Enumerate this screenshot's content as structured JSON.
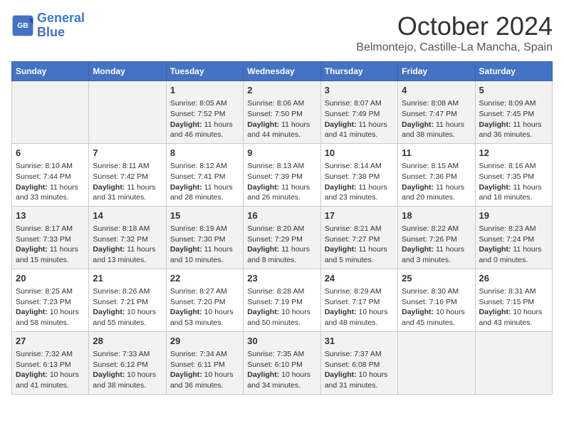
{
  "header": {
    "logo_line1": "General",
    "logo_line2": "Blue",
    "month": "October 2024",
    "location": "Belmontejo, Castille-La Mancha, Spain"
  },
  "days_of_week": [
    "Sunday",
    "Monday",
    "Tuesday",
    "Wednesday",
    "Thursday",
    "Friday",
    "Saturday"
  ],
  "weeks": [
    [
      {
        "day": "",
        "content": ""
      },
      {
        "day": "",
        "content": ""
      },
      {
        "day": "1",
        "content": "Sunrise: 8:05 AM\nSunset: 7:52 PM\nDaylight: 11 hours and 46 minutes."
      },
      {
        "day": "2",
        "content": "Sunrise: 8:06 AM\nSunset: 7:50 PM\nDaylight: 11 hours and 44 minutes."
      },
      {
        "day": "3",
        "content": "Sunrise: 8:07 AM\nSunset: 7:49 PM\nDaylight: 11 hours and 41 minutes."
      },
      {
        "day": "4",
        "content": "Sunrise: 8:08 AM\nSunset: 7:47 PM\nDaylight: 11 hours and 38 minutes."
      },
      {
        "day": "5",
        "content": "Sunrise: 8:09 AM\nSunset: 7:45 PM\nDaylight: 11 hours and 36 minutes."
      }
    ],
    [
      {
        "day": "6",
        "content": "Sunrise: 8:10 AM\nSunset: 7:44 PM\nDaylight: 11 hours and 33 minutes."
      },
      {
        "day": "7",
        "content": "Sunrise: 8:11 AM\nSunset: 7:42 PM\nDaylight: 11 hours and 31 minutes."
      },
      {
        "day": "8",
        "content": "Sunrise: 8:12 AM\nSunset: 7:41 PM\nDaylight: 11 hours and 28 minutes."
      },
      {
        "day": "9",
        "content": "Sunrise: 8:13 AM\nSunset: 7:39 PM\nDaylight: 11 hours and 26 minutes."
      },
      {
        "day": "10",
        "content": "Sunrise: 8:14 AM\nSunset: 7:38 PM\nDaylight: 11 hours and 23 minutes."
      },
      {
        "day": "11",
        "content": "Sunrise: 8:15 AM\nSunset: 7:36 PM\nDaylight: 11 hours and 20 minutes."
      },
      {
        "day": "12",
        "content": "Sunrise: 8:16 AM\nSunset: 7:35 PM\nDaylight: 11 hours and 18 minutes."
      }
    ],
    [
      {
        "day": "13",
        "content": "Sunrise: 8:17 AM\nSunset: 7:33 PM\nDaylight: 11 hours and 15 minutes."
      },
      {
        "day": "14",
        "content": "Sunrise: 8:18 AM\nSunset: 7:32 PM\nDaylight: 11 hours and 13 minutes."
      },
      {
        "day": "15",
        "content": "Sunrise: 8:19 AM\nSunset: 7:30 PM\nDaylight: 11 hours and 10 minutes."
      },
      {
        "day": "16",
        "content": "Sunrise: 8:20 AM\nSunset: 7:29 PM\nDaylight: 11 hours and 8 minutes."
      },
      {
        "day": "17",
        "content": "Sunrise: 8:21 AM\nSunset: 7:27 PM\nDaylight: 11 hours and 5 minutes."
      },
      {
        "day": "18",
        "content": "Sunrise: 8:22 AM\nSunset: 7:26 PM\nDaylight: 11 hours and 3 minutes."
      },
      {
        "day": "19",
        "content": "Sunrise: 8:23 AM\nSunset: 7:24 PM\nDaylight: 11 hours and 0 minutes."
      }
    ],
    [
      {
        "day": "20",
        "content": "Sunrise: 8:25 AM\nSunset: 7:23 PM\nDaylight: 10 hours and 58 minutes."
      },
      {
        "day": "21",
        "content": "Sunrise: 8:26 AM\nSunset: 7:21 PM\nDaylight: 10 hours and 55 minutes."
      },
      {
        "day": "22",
        "content": "Sunrise: 8:27 AM\nSunset: 7:20 PM\nDaylight: 10 hours and 53 minutes."
      },
      {
        "day": "23",
        "content": "Sunrise: 8:28 AM\nSunset: 7:19 PM\nDaylight: 10 hours and 50 minutes."
      },
      {
        "day": "24",
        "content": "Sunrise: 8:29 AM\nSunset: 7:17 PM\nDaylight: 10 hours and 48 minutes."
      },
      {
        "day": "25",
        "content": "Sunrise: 8:30 AM\nSunset: 7:16 PM\nDaylight: 10 hours and 45 minutes."
      },
      {
        "day": "26",
        "content": "Sunrise: 8:31 AM\nSunset: 7:15 PM\nDaylight: 10 hours and 43 minutes."
      }
    ],
    [
      {
        "day": "27",
        "content": "Sunrise: 7:32 AM\nSunset: 6:13 PM\nDaylight: 10 hours and 41 minutes."
      },
      {
        "day": "28",
        "content": "Sunrise: 7:33 AM\nSunset: 6:12 PM\nDaylight: 10 hours and 38 minutes."
      },
      {
        "day": "29",
        "content": "Sunrise: 7:34 AM\nSunset: 6:11 PM\nDaylight: 10 hours and 36 minutes."
      },
      {
        "day": "30",
        "content": "Sunrise: 7:35 AM\nSunset: 6:10 PM\nDaylight: 10 hours and 34 minutes."
      },
      {
        "day": "31",
        "content": "Sunrise: 7:37 AM\nSunset: 6:08 PM\nDaylight: 10 hours and 31 minutes."
      },
      {
        "day": "",
        "content": ""
      },
      {
        "day": "",
        "content": ""
      }
    ]
  ]
}
